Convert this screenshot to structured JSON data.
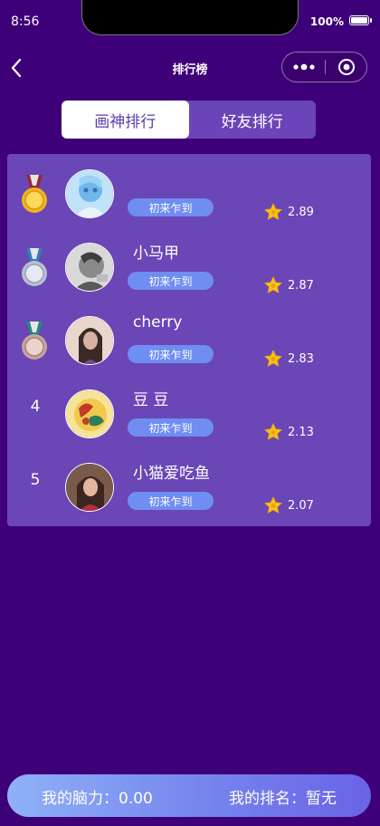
{
  "status_bar": {
    "time": "8:56",
    "battery": "100%"
  },
  "nav": {
    "title": "排行榜"
  },
  "tabs": [
    {
      "label": "画神排行",
      "active": true
    },
    {
      "label": "好友排行",
      "active": false
    }
  ],
  "leaderboard": [
    {
      "rank": "",
      "medal": "gold",
      "name": "",
      "badge": "初来乍到",
      "score": "2.89"
    },
    {
      "rank": "",
      "medal": "silver",
      "name": "小马甲",
      "badge": "初来乍到",
      "score": "2.87"
    },
    {
      "rank": "",
      "medal": "bronze",
      "name": "cherry",
      "badge": "初来乍到",
      "score": "2.83"
    },
    {
      "rank": "4",
      "medal": "",
      "name": "豆 豆",
      "badge": "初来乍到",
      "score": "2.13"
    },
    {
      "rank": "5",
      "medal": "",
      "name": "小猫爱吃鱼",
      "badge": "初来乍到",
      "score": "2.07"
    }
  ],
  "footer": {
    "brain": "我的脑力：0.00",
    "rank": "我的排名：暂无"
  },
  "colors": {
    "background": "#3e0078",
    "panel": "#6a46b6",
    "badge": "#6f8df2",
    "star": "#f7c21b"
  }
}
